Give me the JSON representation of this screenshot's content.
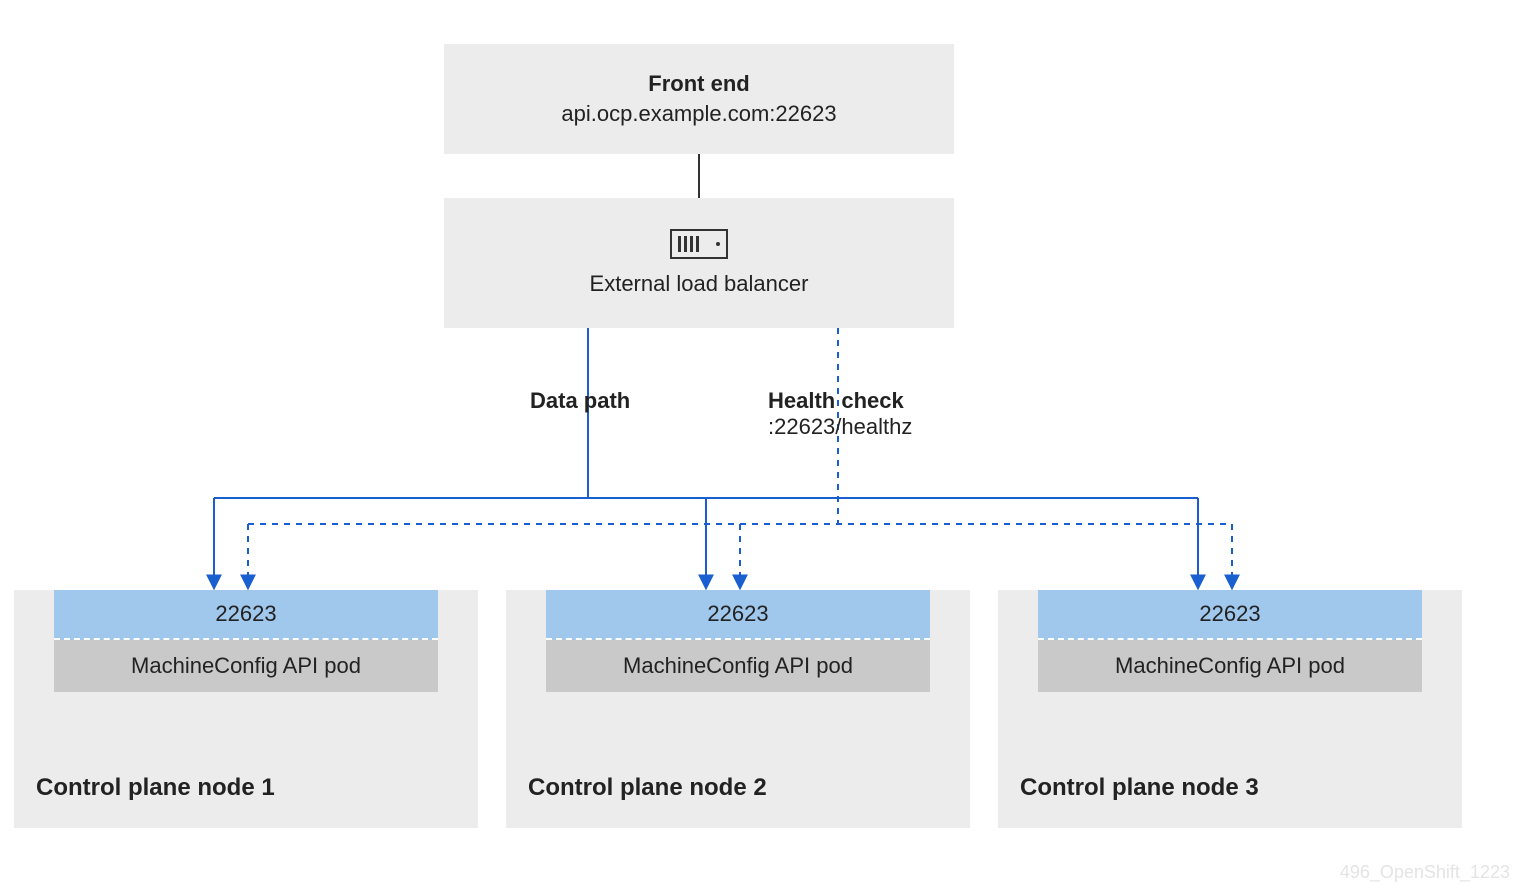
{
  "frontend": {
    "title": "Front end",
    "address": "api.ocp.example.com:22623"
  },
  "loadbalancer": {
    "label": "External load balancer"
  },
  "paths": {
    "data_label": "Data path",
    "health_label": "Health check",
    "health_endpoint": ":22623/healthz"
  },
  "nodes": [
    {
      "port": "22623",
      "pod": "MachineConfig API pod",
      "title": "Control plane node 1"
    },
    {
      "port": "22623",
      "pod": "MachineConfig API pod",
      "title": "Control plane node 2"
    },
    {
      "port": "22623",
      "pod": "MachineConfig API pod",
      "title": "Control plane node 3"
    }
  ],
  "watermark": "496_OpenShift_1223",
  "colors": {
    "blue_stroke": "#1a5fd0",
    "port_fill": "#a0c7ec",
    "box_bg": "#ececec",
    "pod_fill": "#c9c9c9"
  }
}
